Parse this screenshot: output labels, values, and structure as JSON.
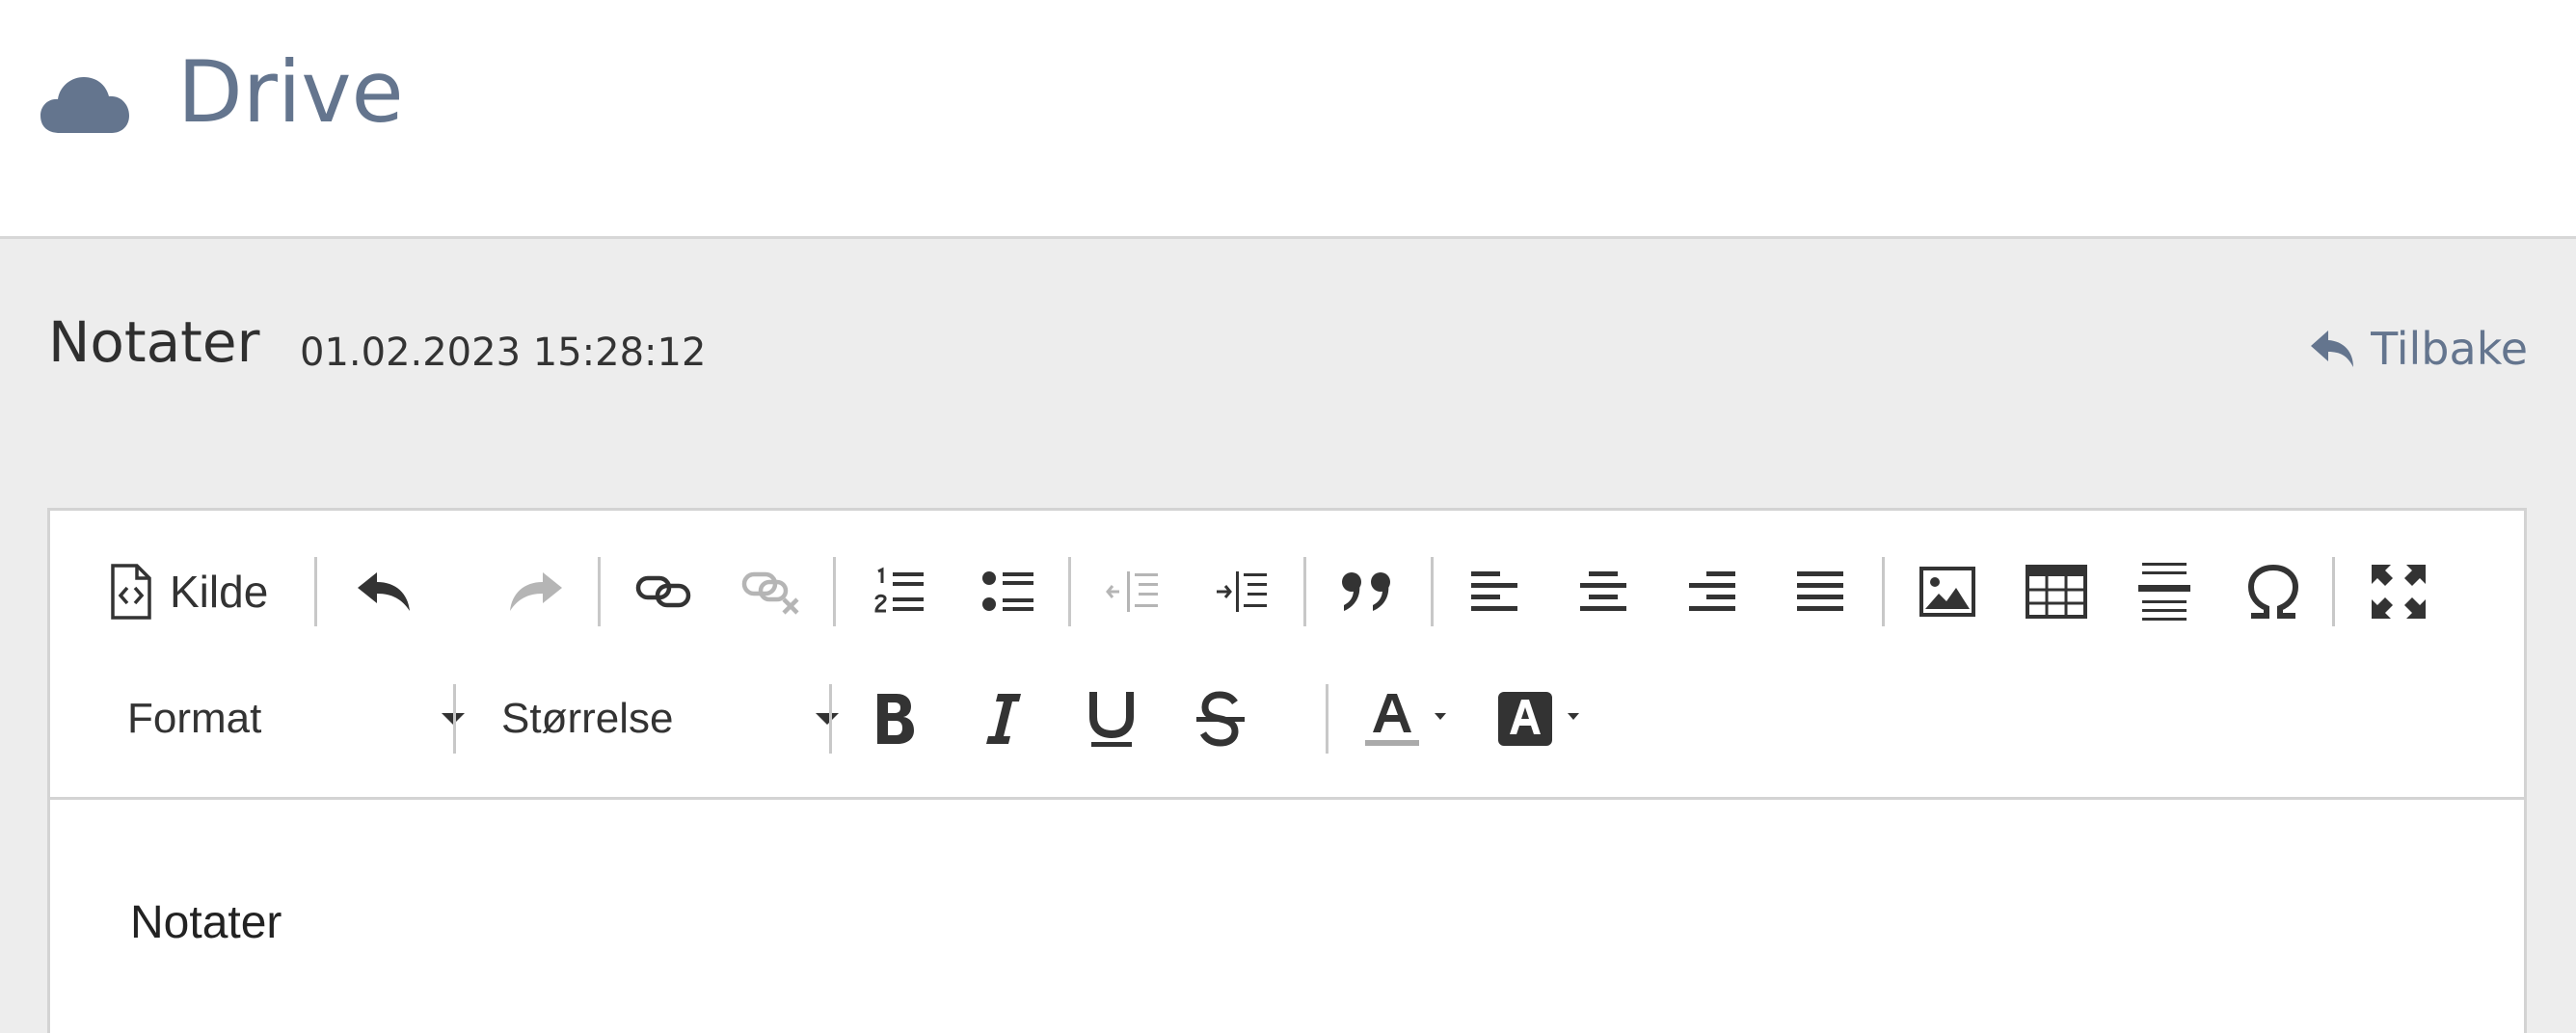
{
  "app": {
    "title": "Drive",
    "logo_icon": "cloud-icon",
    "accent_color": "#64758e"
  },
  "note": {
    "title": "Notater",
    "timestamp": "01.02.2023 15:28:12",
    "back_label": "Tilbake",
    "back_icon": "reply-arrow-icon"
  },
  "toolbar": {
    "source_label": "Kilde",
    "format_label": "Format",
    "size_label": "Størrelse",
    "buttons_row1": [
      "source-icon",
      "undo-icon",
      "redo-icon",
      "link-icon",
      "unlink-icon",
      "numbered-list-icon",
      "bulleted-list-icon",
      "outdent-icon",
      "indent-icon",
      "blockquote-icon",
      "align-left-icon",
      "align-center-icon",
      "align-right-icon",
      "justify-icon",
      "image-icon",
      "table-icon",
      "horizontal-line-icon",
      "special-char-icon",
      "maximize-icon"
    ],
    "buttons_row2": [
      "bold-icon",
      "italic-icon",
      "underline-icon",
      "strikethrough-icon",
      "text-color-icon",
      "background-color-icon"
    ],
    "disabled": [
      "redo-icon",
      "unlink-icon",
      "outdent-icon"
    ]
  },
  "editor": {
    "content": "Notater"
  }
}
